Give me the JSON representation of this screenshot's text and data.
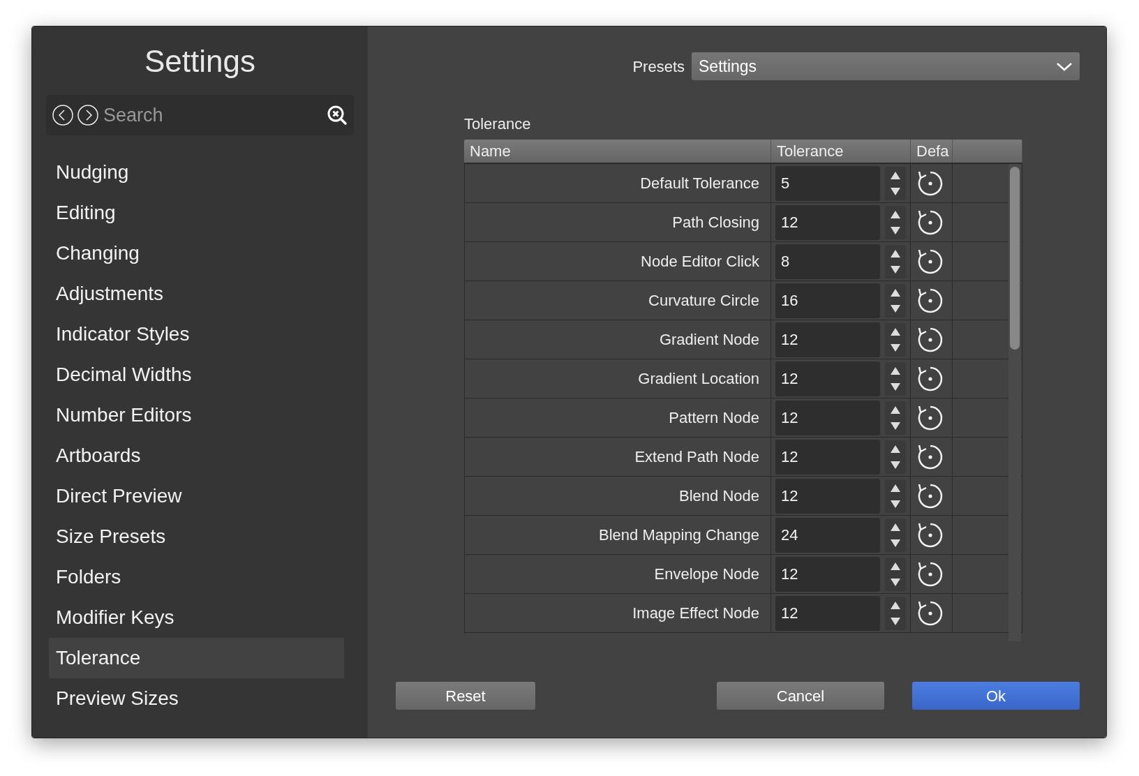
{
  "sidebar": {
    "title": "Settings",
    "search": {
      "placeholder": "Search"
    },
    "items": [
      {
        "label": "Nudging",
        "selected": false
      },
      {
        "label": "Editing",
        "selected": false
      },
      {
        "label": "Changing",
        "selected": false
      },
      {
        "label": "Adjustments",
        "selected": false
      },
      {
        "label": "Indicator Styles",
        "selected": false
      },
      {
        "label": "Decimal Widths",
        "selected": false
      },
      {
        "label": "Number Editors",
        "selected": false
      },
      {
        "label": "Artboards",
        "selected": false
      },
      {
        "label": "Direct Preview",
        "selected": false
      },
      {
        "label": "Size Presets",
        "selected": false
      },
      {
        "label": "Folders",
        "selected": false
      },
      {
        "label": "Modifier Keys",
        "selected": false
      },
      {
        "label": "Tolerance",
        "selected": true
      },
      {
        "label": "Preview Sizes",
        "selected": false
      }
    ]
  },
  "presets": {
    "label": "Presets",
    "value": "Settings"
  },
  "table": {
    "title": "Tolerance",
    "columns": [
      "Name",
      "Tolerance",
      "Defa"
    ],
    "rows": [
      {
        "name": "Default Tolerance",
        "value": "5"
      },
      {
        "name": "Path Closing",
        "value": "12"
      },
      {
        "name": "Node Editor Click",
        "value": "8"
      },
      {
        "name": "Curvature Circle",
        "value": "16"
      },
      {
        "name": "Gradient Node",
        "value": "12"
      },
      {
        "name": "Gradient Location",
        "value": "12"
      },
      {
        "name": "Pattern Node",
        "value": "12"
      },
      {
        "name": "Extend Path Node",
        "value": "12"
      },
      {
        "name": "Blend Node",
        "value": "12"
      },
      {
        "name": "Blend Mapping Change",
        "value": "24"
      },
      {
        "name": "Envelope Node",
        "value": "12"
      },
      {
        "name": "Image Effect Node",
        "value": "12"
      }
    ]
  },
  "buttons": [
    {
      "label": "Reset",
      "kind": "plain"
    },
    {
      "label": "Cancel",
      "kind": "plain"
    },
    {
      "label": "Ok",
      "kind": "primary"
    }
  ]
}
